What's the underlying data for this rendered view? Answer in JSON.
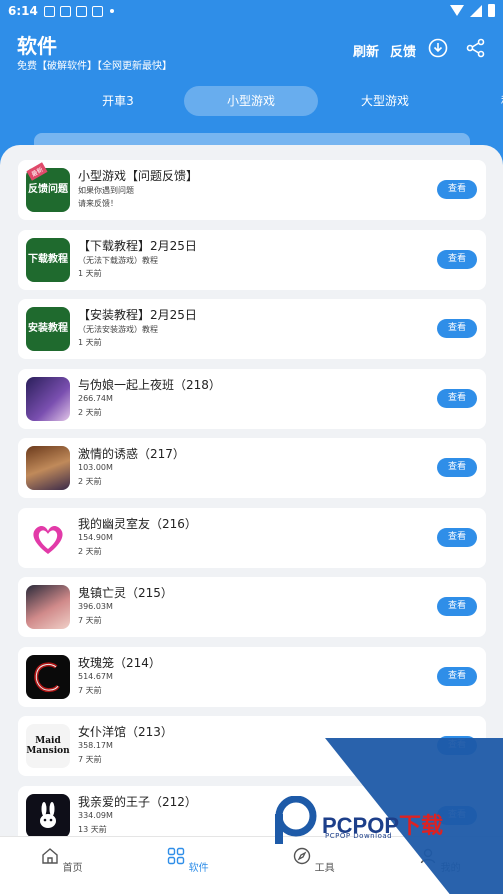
{
  "status_bar": {
    "time": "6:14"
  },
  "header": {
    "title": "软件",
    "subtitle": "免费【破解软件】【全网更新最快】",
    "refresh_label": "刷新",
    "feedback_label": "反馈"
  },
  "tabs": [
    {
      "label": "开車3"
    },
    {
      "label": "小型游戏"
    },
    {
      "label": "大型游戏"
    },
    {
      "label": "种"
    }
  ],
  "items": [
    {
      "name": "小型游戏【问题反馈】",
      "line2": "如果你遇到问题",
      "line3": "请来反馈！",
      "thumb_text": "反馈问题",
      "thumb_badge": "最新",
      "button": "查看"
    },
    {
      "name": "【下载教程】2月25日",
      "line2": "（无法下载游戏）教程",
      "line3": "1 天前",
      "thumb_text": "下载教程",
      "button": "查看"
    },
    {
      "name": "【安装教程】2月25日",
      "line2": "（无法安装游戏）教程",
      "line3": "1 天前",
      "thumb_text": "安装教程",
      "button": "查看"
    },
    {
      "name": "与伪娘一起上夜班（218）",
      "line2": "266.74M",
      "line3": "2 天前",
      "button": "查看"
    },
    {
      "name": "激情的诱惑（217）",
      "line2": "103.00M",
      "line3": "2 天前",
      "button": "查看"
    },
    {
      "name": "我的幽灵室友（216）",
      "line2": "154.90M",
      "line3": "2 天前",
      "button": "查看"
    },
    {
      "name": "鬼镇亡灵（215）",
      "line2": "396.03M",
      "line3": "7 天前",
      "button": "查看"
    },
    {
      "name": "玫瑰笼（214）",
      "line2": "514.67M",
      "line3": "7 天前",
      "button": "查看"
    },
    {
      "name": "女仆洋馆（213）",
      "line2": "358.17M",
      "line3": "7 天前",
      "thumb_text": "Maid Mansion",
      "button": "查看"
    },
    {
      "name": "我亲爱的王子（212）",
      "line2": "334.09M",
      "line3": "13 天前",
      "button": "查看"
    }
  ],
  "bottom_nav": [
    {
      "label": "首页"
    },
    {
      "label": "软件"
    },
    {
      "label": "工具"
    },
    {
      "label": "我的"
    }
  ],
  "watermark": {
    "brand_main": "PCPOP",
    "brand_suffix": "下载",
    "brand_sub": "PCPOP Download"
  },
  "colors": {
    "primary": "#2f8ee8",
    "thumb_green": "#1f6a2e",
    "badge": "#e04a6a"
  }
}
